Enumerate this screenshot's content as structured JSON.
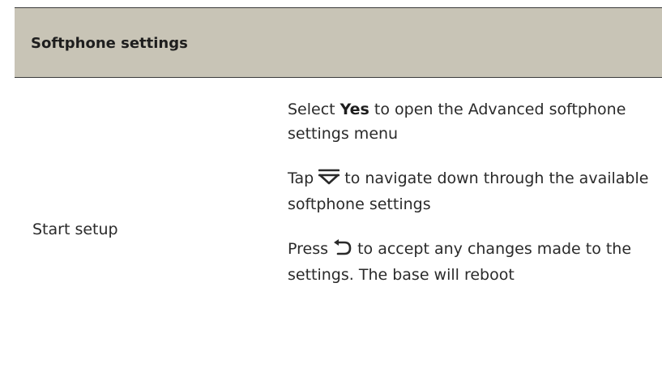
{
  "header": {
    "title": "Softphone settings"
  },
  "row": {
    "label": "Start setup"
  },
  "instructions": [
    {
      "before": "Select ",
      "bold": "Yes",
      "after": " to open the Advanced softphone settings menu"
    },
    {
      "before": "Tap ",
      "icon": "scroll-down-icon",
      "after": " to navigate down through the available softphone settings"
    },
    {
      "before": "Press ",
      "icon": "return-icon",
      "after": " to accept any changes made to the settings. The base will reboot"
    }
  ],
  "colors": {
    "header_background": "#c8c4b6",
    "rule": "#3a3a3a",
    "text": "#2a2a2a"
  }
}
